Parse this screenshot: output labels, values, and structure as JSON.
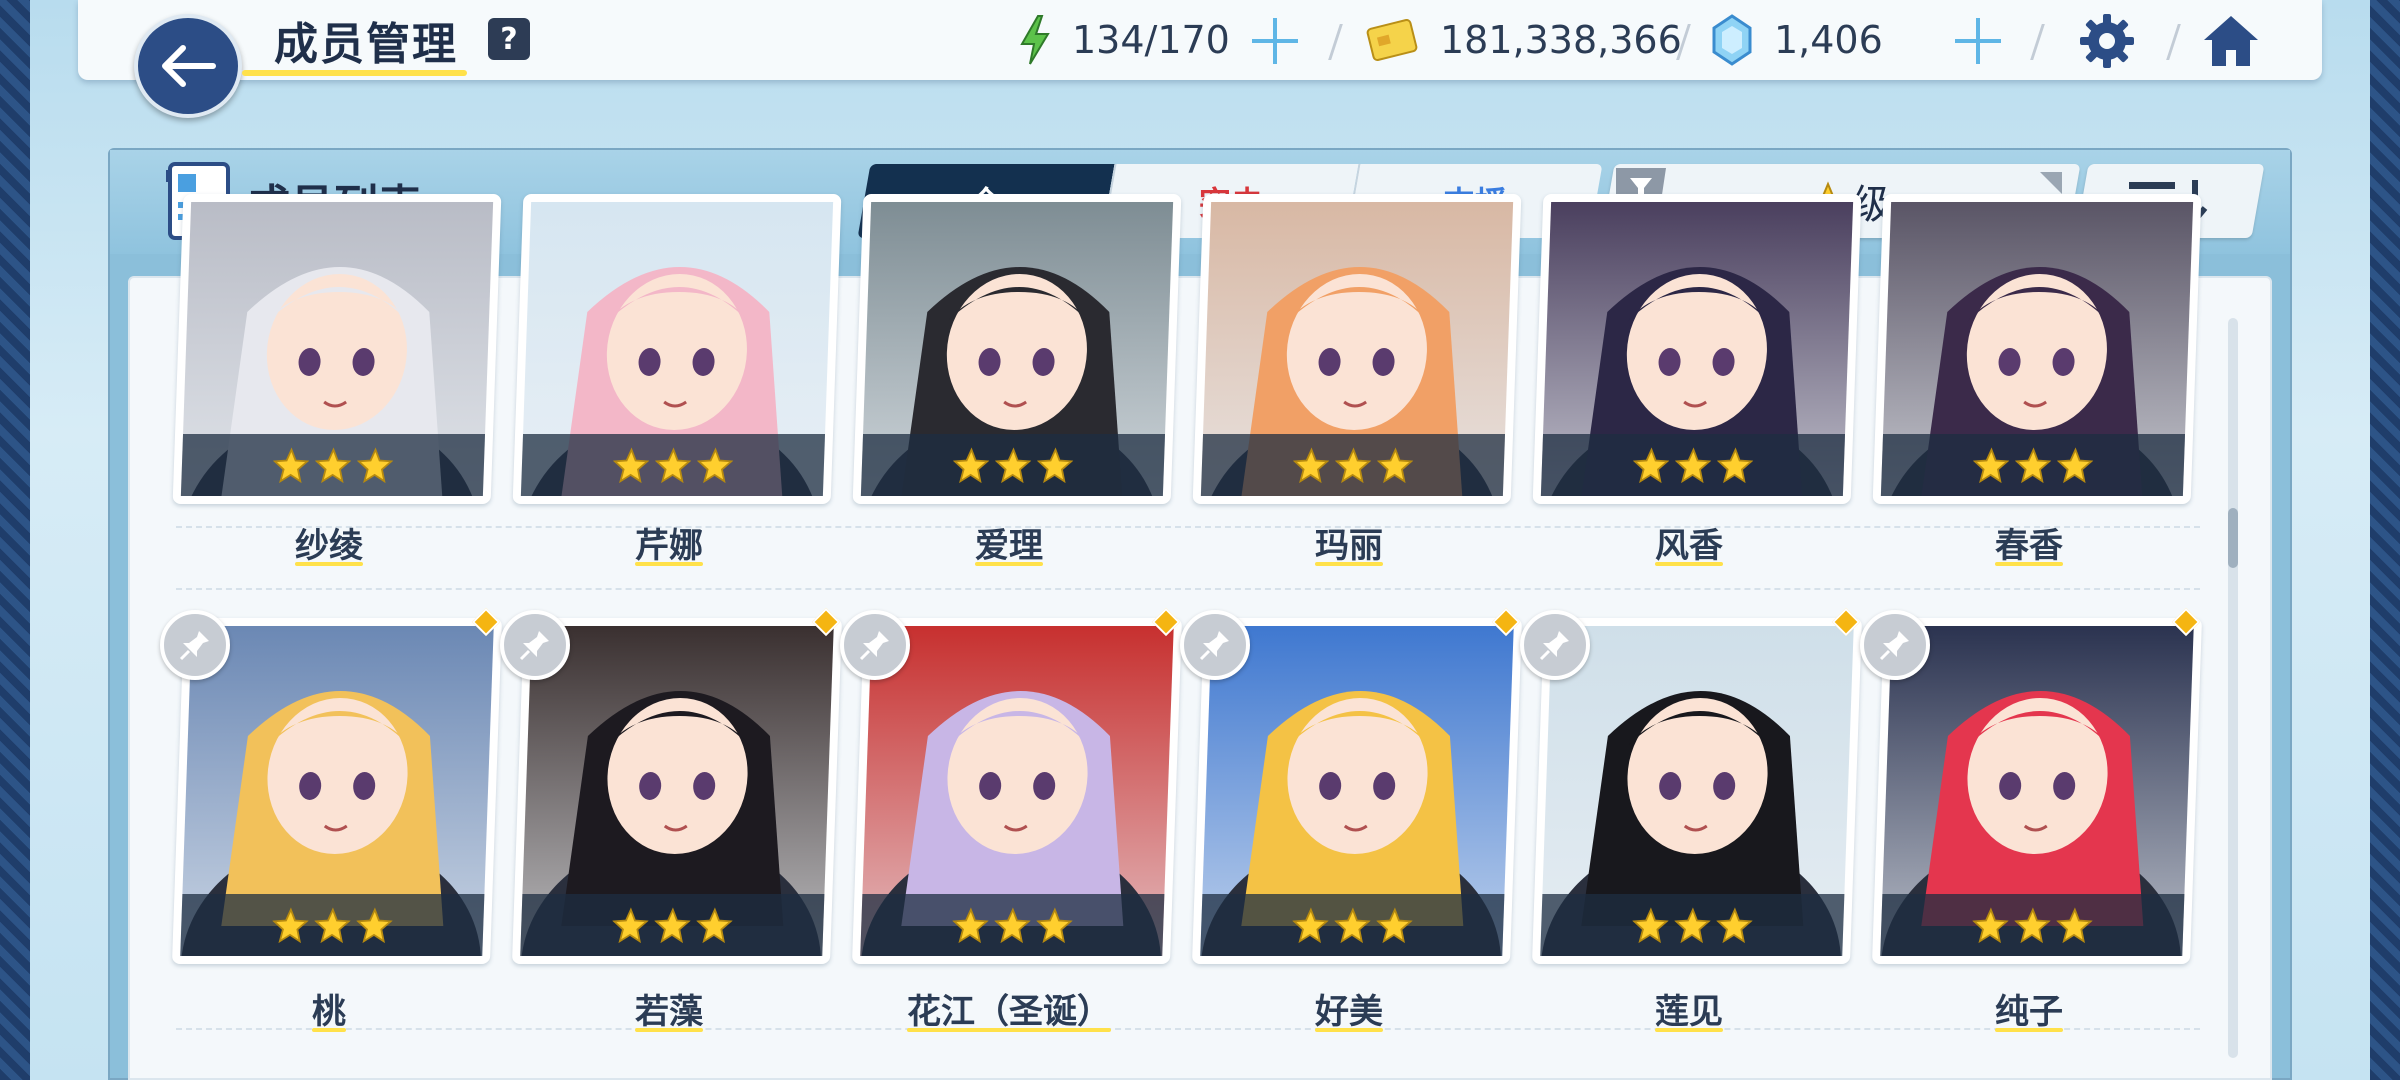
{
  "header": {
    "title": "成员管理",
    "help_label": "?",
    "ap": "134/170",
    "credits": "181,338,366",
    "gems": "1,406"
  },
  "panel": {
    "title": "成员列表",
    "tabs": [
      {
        "label": "全",
        "color": "#ffffff"
      },
      {
        "label": "突击",
        "color": "#d8363b"
      },
      {
        "label": "支援",
        "color": "#3a7de0"
      }
    ],
    "sort_label": "级"
  },
  "members": [
    {
      "name": "纱绫",
      "stars": 3,
      "pinned": false,
      "hair": "#e7e8ee",
      "bg": "#b9bcc6"
    },
    {
      "name": "芹娜",
      "stars": 3,
      "pinned": false,
      "hair": "#f3b7c8",
      "bg": "#d6e6f1"
    },
    {
      "name": "爱理",
      "stars": 3,
      "pinned": false,
      "hair": "#2a2a30",
      "bg": "#7e8d94"
    },
    {
      "name": "玛丽",
      "stars": 3,
      "pinned": false,
      "hair": "#f1a066",
      "bg": "#d8b8a4"
    },
    {
      "name": "风香",
      "stars": 3,
      "pinned": false,
      "hair": "#2c2746",
      "bg": "#4a3f5e"
    },
    {
      "name": "春香",
      "stars": 3,
      "pinned": false,
      "hair": "#3b2a4a",
      "bg": "#5a5566"
    },
    {
      "name": "桃",
      "stars": 3,
      "pinned": true,
      "hair": "#f2c15a",
      "bg": "#6b88b4"
    },
    {
      "name": "若藻",
      "stars": 3,
      "pinned": true,
      "hair": "#1d1a20",
      "bg": "#3a3030"
    },
    {
      "name": "花江（圣诞）",
      "stars": 3,
      "pinned": true,
      "hair": "#c8b6e6",
      "bg": "#c7302f"
    },
    {
      "name": "好美",
      "stars": 3,
      "pinned": true,
      "hair": "#f4c245",
      "bg": "#3f78d0"
    },
    {
      "name": "莲见",
      "stars": 3,
      "pinned": true,
      "hair": "#18181d",
      "bg": "#cfdfe9"
    },
    {
      "name": "纯子",
      "stars": 3,
      "pinned": true,
      "hair": "#e4364e",
      "bg": "#2b3350"
    }
  ]
}
